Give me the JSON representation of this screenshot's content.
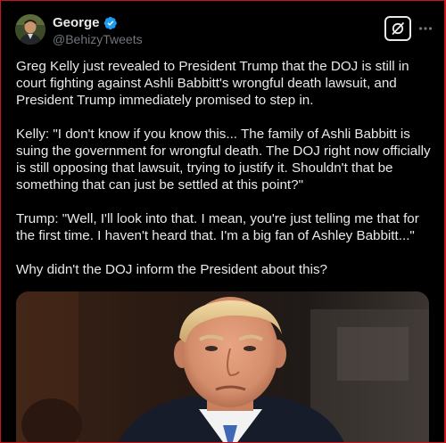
{
  "author": {
    "display_name": "George",
    "handle": "@BehizyTweets",
    "verified": true,
    "verified_color": "#1d9bf0"
  },
  "header_actions": {
    "grok_icon": "grok-icon",
    "more_icon": "more-horizontal-icon"
  },
  "tweet": {
    "paragraphs": [
      "Greg Kelly just revealed to President Trump that the DOJ is still in court fighting against Ashli Babbitt's wrongful death lawsuit, and President Trump immediately promised to step in.",
      "Kelly: \"I don't know if you know this... The family of Ashli Babbitt is suing the government for wrongful death. The DOJ right now officially is still opposing that lawsuit, trying to justify it. Shouldn't that be something that can just be settled at this point?\"",
      "Trump: \"Well, I'll look into that. I mean, you're just telling me that for the first time. I haven't heard that. I'm a big fan of Ashley Babbitt...\"",
      "Why didn't the DOJ inform the President about this?"
    ]
  },
  "colors": {
    "background": "#000000",
    "text": "#e7e9ea",
    "secondary_text": "#71767b",
    "frame_border": "#c9161d"
  }
}
